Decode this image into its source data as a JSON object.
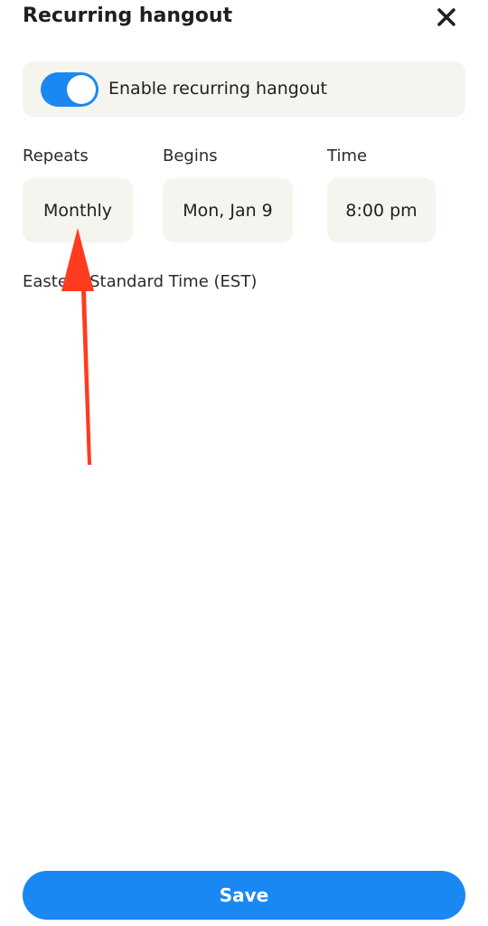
{
  "header": {
    "title": "Recurring hangout",
    "close_icon": "close-icon"
  },
  "toggle": {
    "label": "Enable recurring hangout",
    "enabled": true,
    "accent_color": "#1a88f2"
  },
  "fields": {
    "repeats": {
      "label": "Repeats",
      "value": "Monthly"
    },
    "begins": {
      "label": "Begins",
      "value": "Mon, Jan 9"
    },
    "time": {
      "label": "Time",
      "value": "8:00 pm"
    }
  },
  "timezone": "Eastern Standard Time (EST)",
  "save_label": "Save",
  "annotation": {
    "icon": "red-arrow-icon",
    "color": "#ff3b1f"
  }
}
